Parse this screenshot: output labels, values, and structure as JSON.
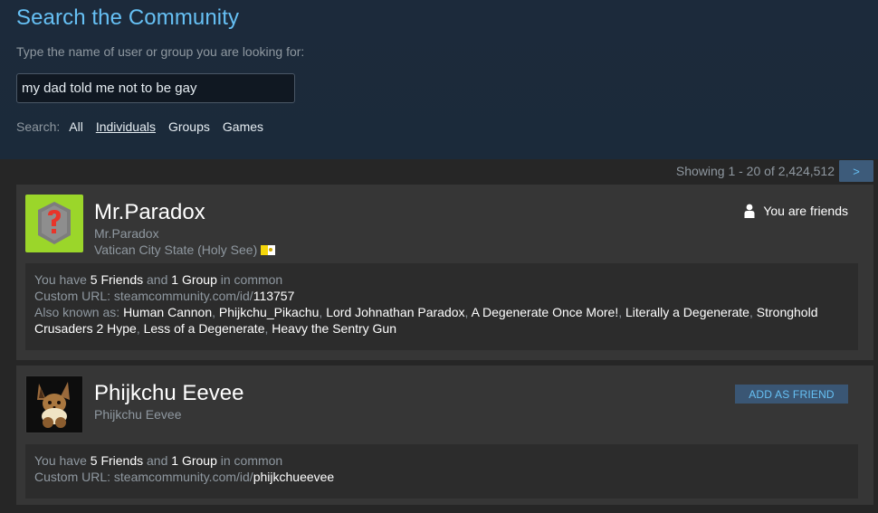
{
  "header": {
    "title": "Search the Community",
    "prompt": "Type the name of user or group you are looking for:",
    "search_value": "my dad told me not to be gay",
    "filter_label": "Search:",
    "filters": [
      "All",
      "Individuals",
      "Groups",
      "Games"
    ],
    "active_filter": "Individuals"
  },
  "results": {
    "showing": "Showing 1 - 20 of 2,424,512",
    "next_label": ">"
  },
  "cards": [
    {
      "name": "Mr.Paradox",
      "subname": "Mr.Paradox",
      "location": "Vatican City State (Holy See)",
      "status": "You are friends",
      "common_prefix": "You have ",
      "friends": "5 Friends",
      "and": " and ",
      "groups": "1 Group",
      "in_common": " in common",
      "url_prefix": "Custom URL: steamcommunity.com/id/",
      "url_id": "113757",
      "aka_prefix": "Also known as: ",
      "aliases": [
        "Human Cannon",
        "Phijkchu_Pikachu",
        "Lord Johnathan Paradox",
        "A Degenerate Once More!",
        "Literally a Degenerate",
        "Stronghold Crusaders 2 Hype",
        "Less of a Degenerate",
        "Heavy the Sentry Gun"
      ]
    },
    {
      "name": "Phijkchu Eevee",
      "subname": "Phijkchu Eevee",
      "button": "ADD AS FRIEND",
      "common_prefix": "You have ",
      "friends": "5 Friends",
      "and": " and ",
      "groups": "1 Group",
      "in_common": " in common",
      "url_prefix": "Custom URL: steamcommunity.com/id/",
      "url_id": "phijkchueevee"
    }
  ],
  "colors": {
    "accent": "#66c0f4",
    "header_bg": "#1b2838",
    "card_bg": "#363636"
  }
}
